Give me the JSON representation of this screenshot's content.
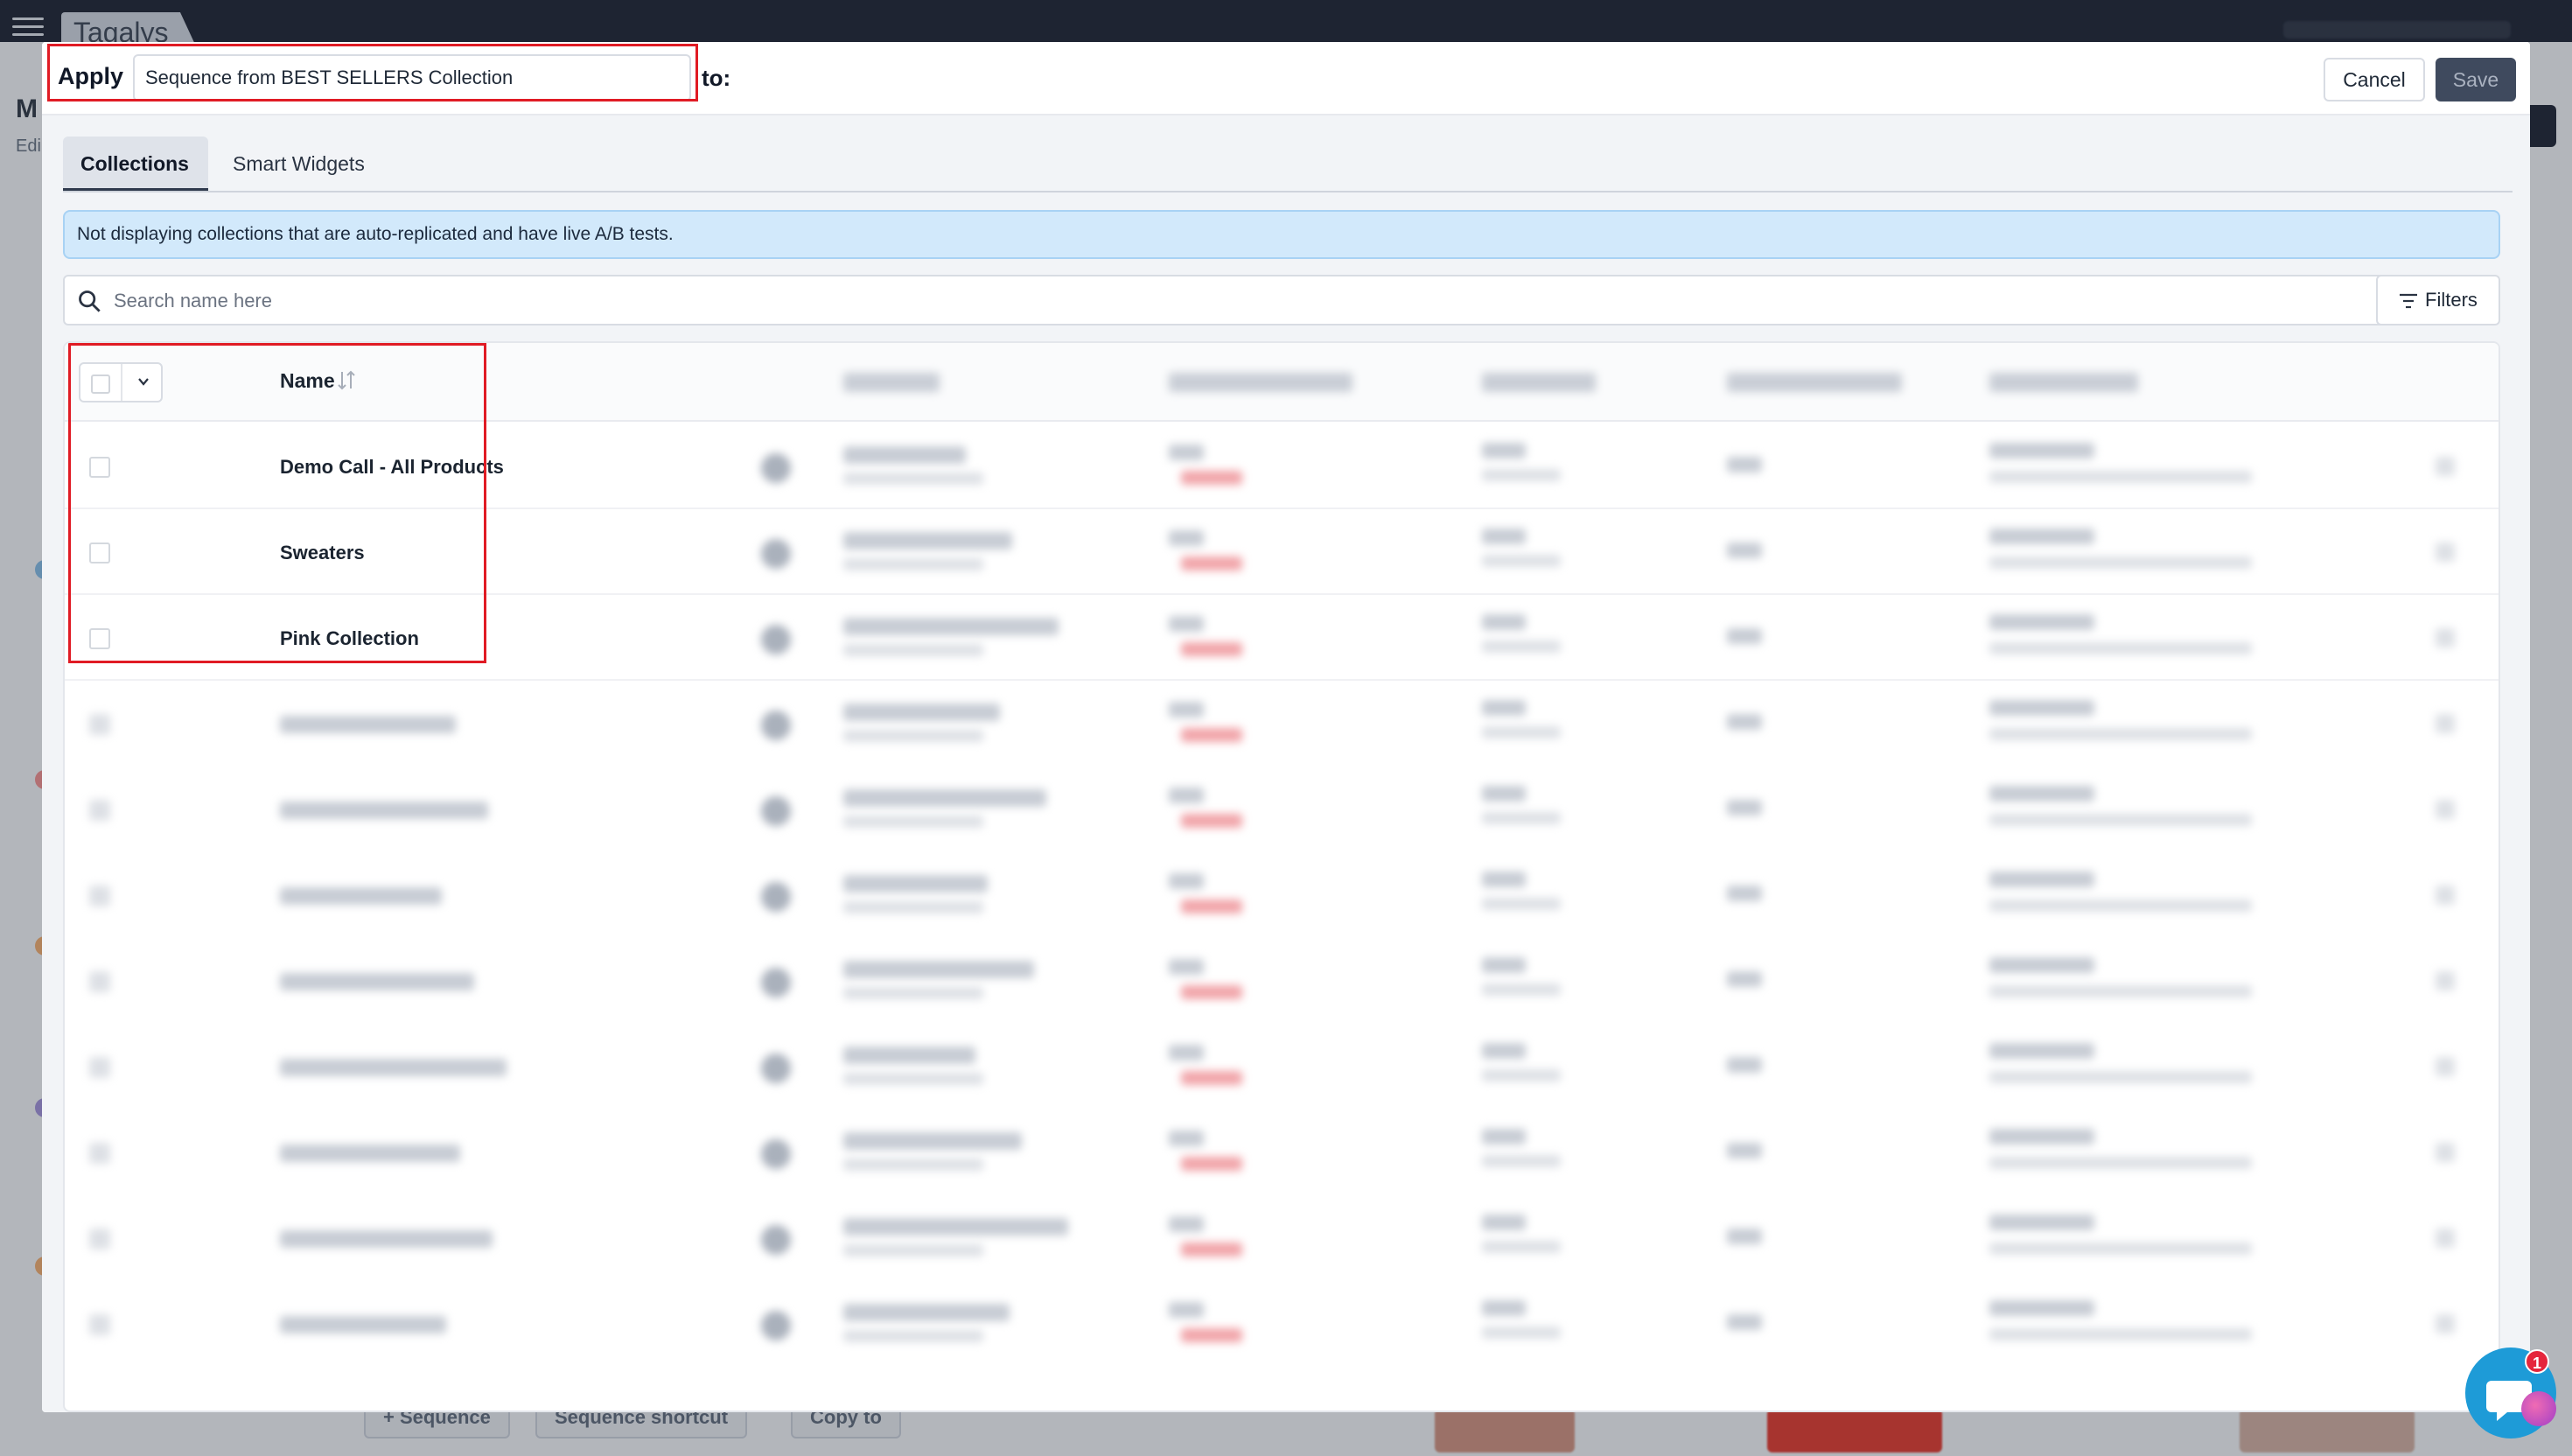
{
  "app": {
    "logo": "Tagalys"
  },
  "background": {
    "page_title_fragment": "M",
    "page_sub_fragment": "Edi",
    "bottom_buttons": [
      "+ Sequence",
      "Sequence shortcut",
      "Copy to"
    ]
  },
  "modal": {
    "apply_label": "Apply",
    "apply_value": "Sequence from BEST SELLERS Collection",
    "to_label": "to:",
    "cancel_label": "Cancel",
    "save_label": "Save",
    "tabs": [
      {
        "label": "Collections",
        "active": true
      },
      {
        "label": "Smart Widgets",
        "active": false
      }
    ],
    "info_message": "Not displaying collections that are auto-replicated and have live A/B tests.",
    "search_placeholder": "Search name here",
    "filters_label": "Filters",
    "table": {
      "name_header": "Name",
      "rows": [
        {
          "name": "Demo Call - All Products"
        },
        {
          "name": "Sweaters"
        },
        {
          "name": "Pink Collection"
        }
      ]
    }
  },
  "chat_widget": {
    "badge_count": "1"
  },
  "colors": {
    "highlight": "#e01b24",
    "info_bg": "#d2e9fb",
    "save_bg": "#3f4a5e",
    "topbar": "#1b2130",
    "chat": "#1e9bd7"
  }
}
